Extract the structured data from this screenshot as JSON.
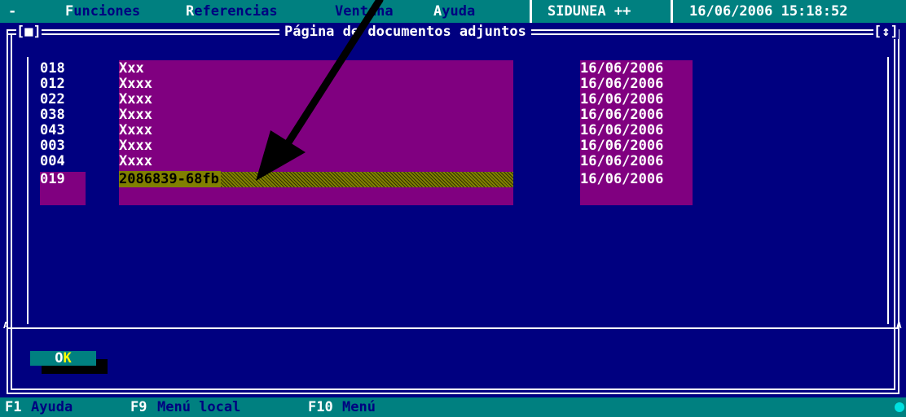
{
  "menu": {
    "dash": "-",
    "items": [
      {
        "hot": "F",
        "rest": "unciones"
      },
      {
        "hot": "R",
        "rest": "eferencias"
      },
      {
        "hot": "",
        "rest": "Ventana"
      },
      {
        "hot": "A",
        "rest": "yuda"
      }
    ]
  },
  "brand": "SIDUNEA ++",
  "clock": "16/06/2006 15:18:52",
  "window": {
    "title": "Página de documentos adjuntos",
    "left_bracket": "[■]",
    "right_bracket": "[↕]",
    "side_flag": "A"
  },
  "documents": {
    "rows": [
      {
        "code": "018",
        "name": "Xxx",
        "date": "16/06/2006"
      },
      {
        "code": "012",
        "name": "Xxxx",
        "date": "16/06/2006"
      },
      {
        "code": "022",
        "name": "Xxxx",
        "date": "16/06/2006"
      },
      {
        "code": "038",
        "name": "Xxxx",
        "date": "16/06/2006"
      },
      {
        "code": "043",
        "name": "Xxxx",
        "date": "16/06/2006"
      },
      {
        "code": "003",
        "name": "Xxxx",
        "date": "16/06/2006"
      },
      {
        "code": "004",
        "name": "Xxxx",
        "date": "16/06/2006"
      }
    ],
    "editing": {
      "code": "019",
      "name": "2086839-68fb",
      "date": "16/06/2006"
    }
  },
  "ok_button": {
    "first": "O",
    "hot": "K"
  },
  "statusbar": [
    {
      "key": "F1",
      "label": "Ayuda"
    },
    {
      "key": "F9",
      "label": "Menú local"
    },
    {
      "key": "F10",
      "label": "Menú"
    }
  ],
  "colors": {
    "background": "#000080",
    "bar": "#008080",
    "field": "#800080",
    "selection": "#808000",
    "hotkey": "#ffff00"
  }
}
